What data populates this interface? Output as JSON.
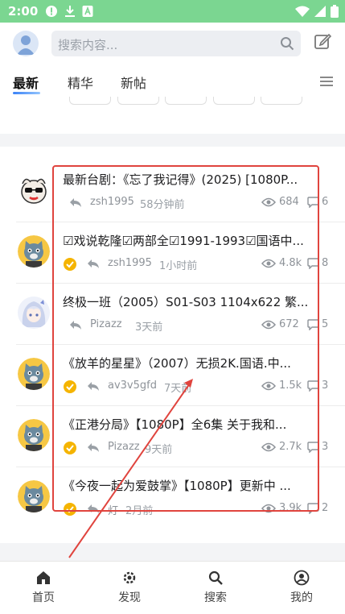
{
  "status_bar": {
    "time": "2:00",
    "icons": [
      "alert-circle-icon",
      "download-icon",
      "app-a-icon",
      "wifi-icon",
      "signal-icon",
      "battery-icon"
    ]
  },
  "header": {
    "search_placeholder": "搜索内容...",
    "tabs": [
      {
        "label": "最新",
        "active": true
      },
      {
        "label": "精华",
        "active": false
      },
      {
        "label": "新帖",
        "active": false
      }
    ]
  },
  "posts": [
    {
      "title": "最新台剧：《忘了我记得》(2025) [1080P...",
      "author": "zsh1995",
      "time": "58分钟前",
      "views": "684",
      "comments": "6",
      "verified": false,
      "avatar": "sunglasses-dog"
    },
    {
      "title": "☑戏说乾隆☑两部全☑1991-1993☑国语中...",
      "author": "zsh1995",
      "time": "1小时前",
      "views": "4.8k",
      "comments": "8",
      "verified": true,
      "avatar": "cartoon-cat"
    },
    {
      "title": "终极一班（2005）S01-S03 1104x622 繁...",
      "author": "Pizazz",
      "time": "3天前",
      "views": "672",
      "comments": "5",
      "verified": false,
      "avatar": "anime-girl"
    },
    {
      "title": "《放羊的星星》（2007）无损2K.国语.中...",
      "author": "av3v5gfd",
      "time": "7天前",
      "views": "1.5k",
      "comments": "3",
      "verified": true,
      "avatar": "cartoon-cat"
    },
    {
      "title": "《正港分局》【1080P】全6集 关于我和...",
      "author": "Pizazz",
      "time": "9天前",
      "views": "2.7k",
      "comments": "3",
      "verified": true,
      "avatar": "cartoon-cat"
    },
    {
      "title": "《今夜一起为爱鼓掌》【1080P】更新中 ...",
      "author": "灯",
      "time": "2月前",
      "views": "3.9k",
      "comments": "2",
      "verified": true,
      "avatar": "cartoon-cat"
    }
  ],
  "bottom_nav": [
    {
      "label": "首页",
      "icon": "home-icon",
      "active": true
    },
    {
      "label": "发现",
      "icon": "discover-icon",
      "active": false
    },
    {
      "label": "搜索",
      "icon": "search-icon",
      "active": false
    },
    {
      "label": "我的",
      "icon": "profile-icon",
      "active": false
    }
  ],
  "colors": {
    "status_bar": "#7bd691",
    "accent": "#3b82f6",
    "annotation_red": "#e0443e",
    "verified": "#f5b400"
  }
}
